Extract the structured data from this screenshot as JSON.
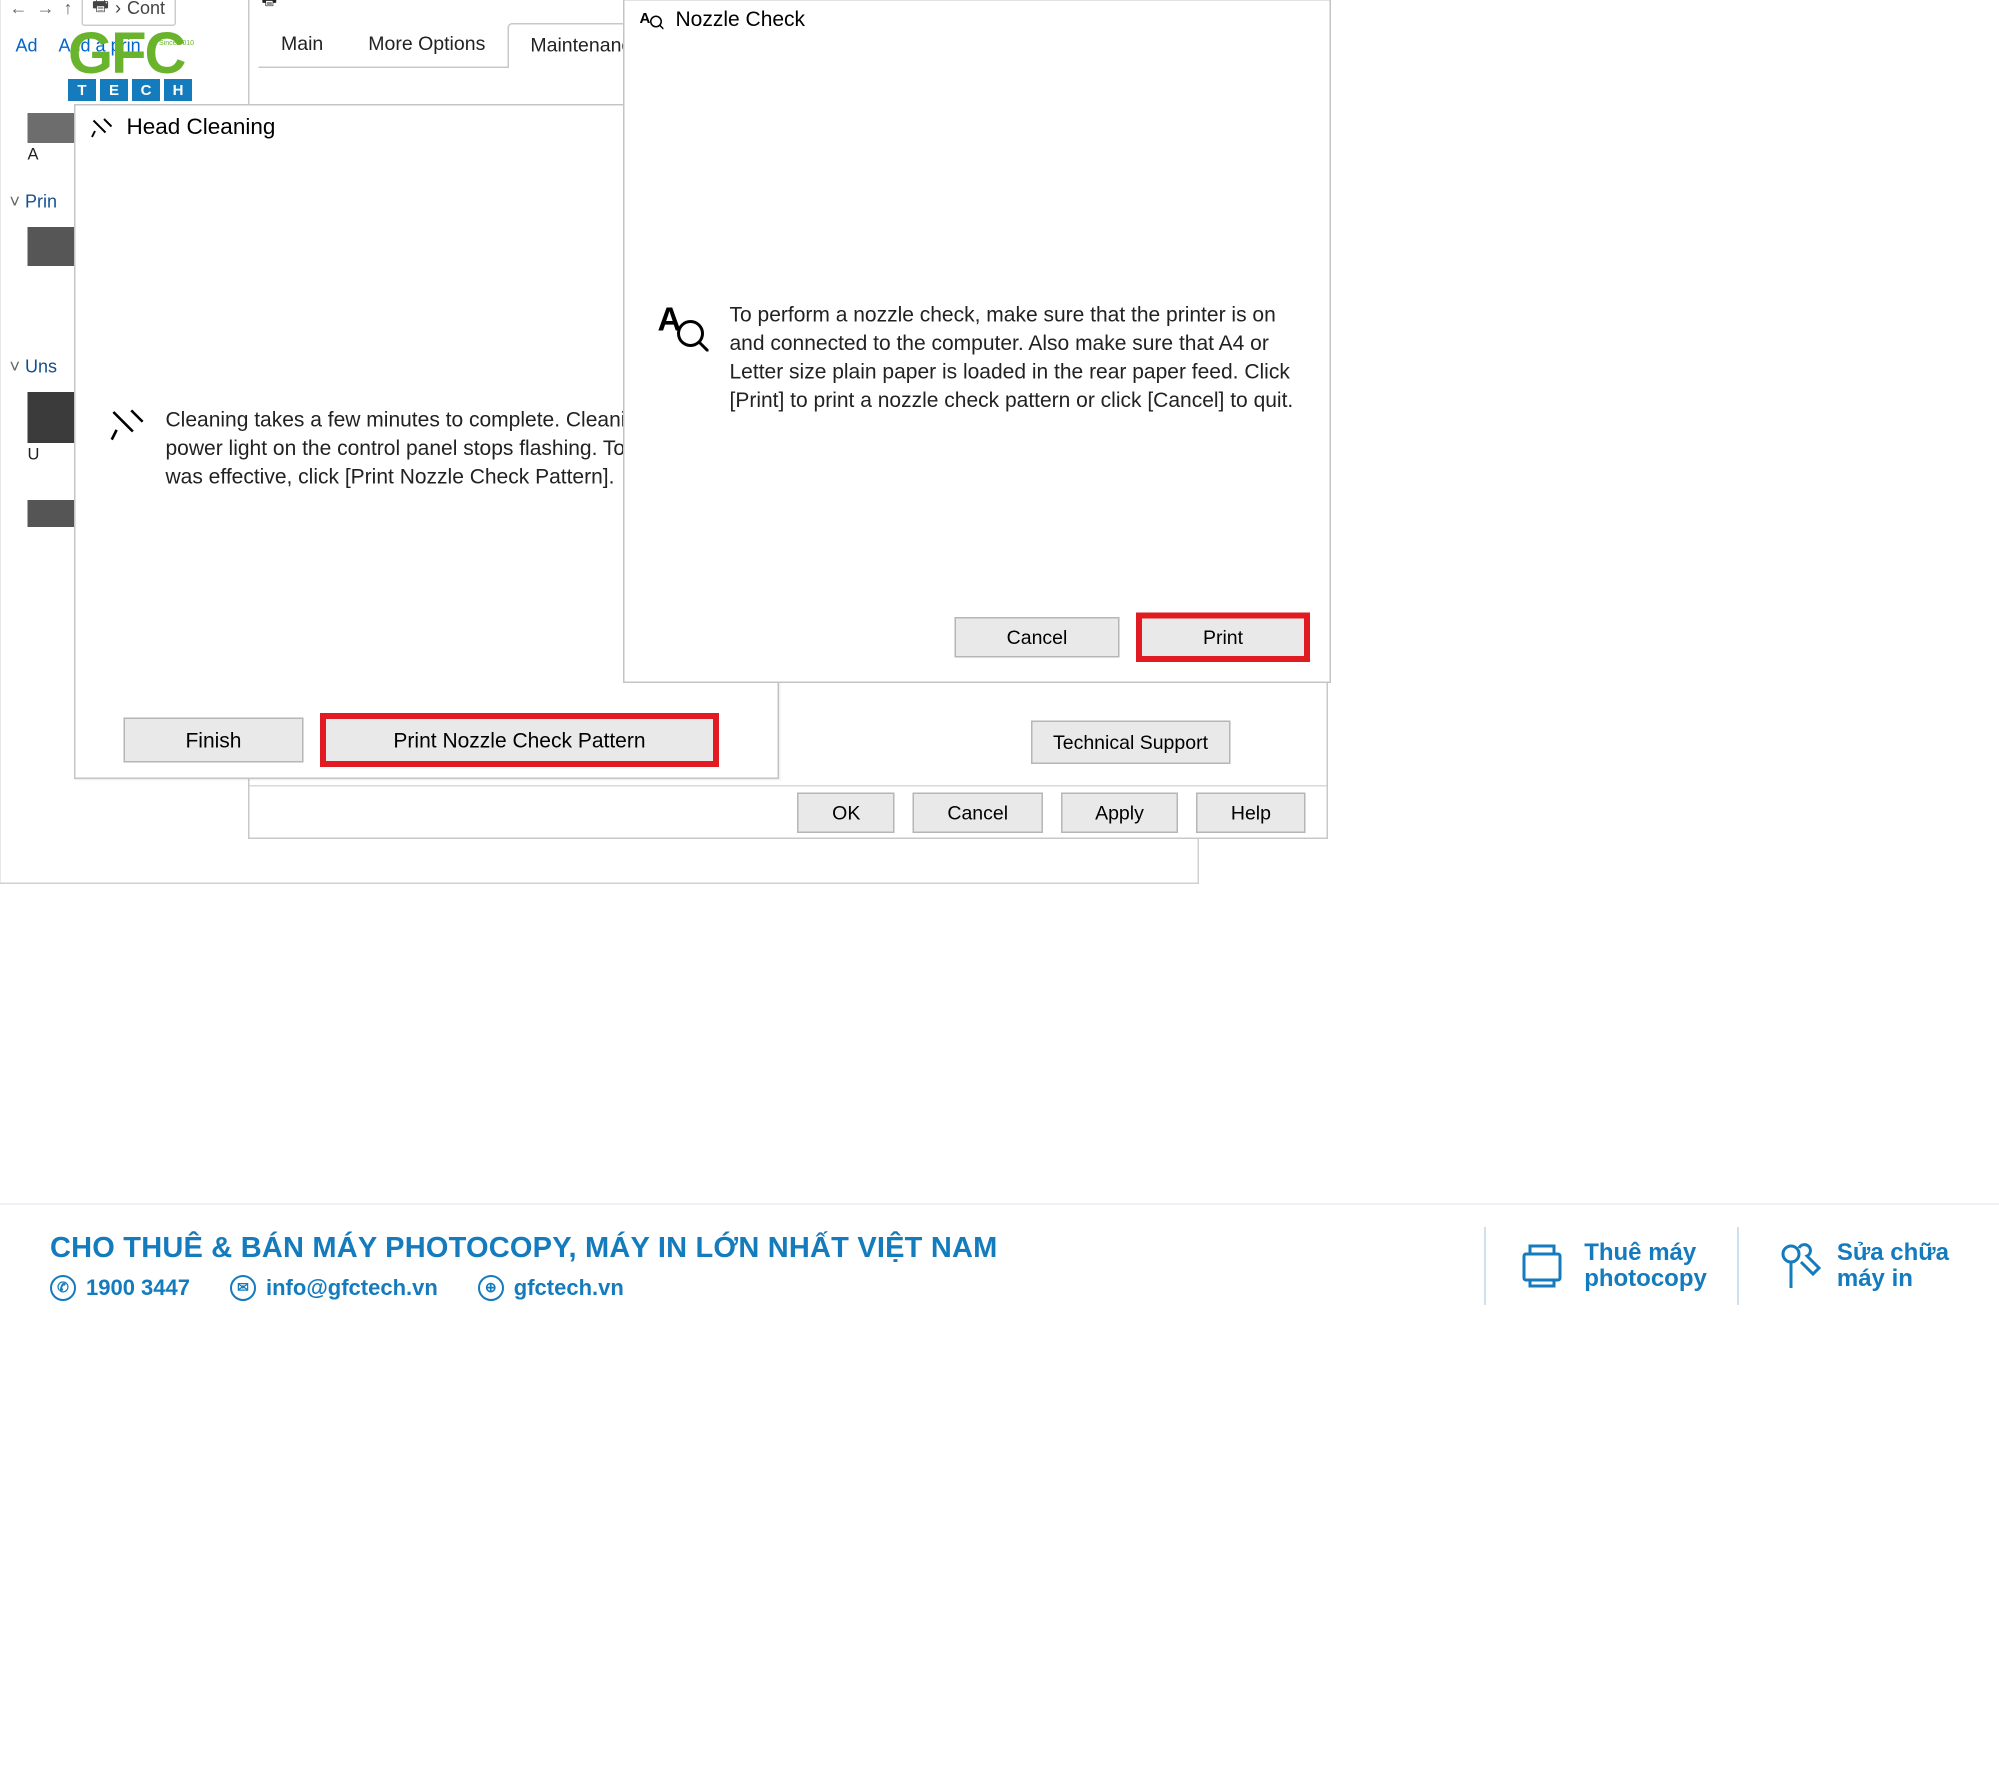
{
  "explorer": {
    "crumb_label": "Cont",
    "cmd_add_device": "Ad",
    "cmd_add_printer": "Add a prin",
    "group_printers": "Prin",
    "dev_label_A": "A",
    "group_unspecified": "Uns",
    "dev_label_U": "U"
  },
  "prefs": {
    "tabs": {
      "main": "Main",
      "more": "More Options",
      "maint": "Maintenance"
    },
    "tech_support": "Technical Support",
    "ok": "OK",
    "cancel": "Cancel",
    "apply": "Apply",
    "help": "Help"
  },
  "headclean": {
    "title": "Head Cleaning",
    "message": "Cleaning takes a few minutes to complete. Cleaning is finished when the power light on the control panel stops flashing. To verify that cleaning was effective, click [Print Nozzle Check Pattern].",
    "message_visible": "Cleaning takes a few minutes to complete. Cleaning is finishe the power light on the control panel stops flashing. To verify cleaning was effective, click [Print Nozzle Check Pattern].",
    "finish": "Finish",
    "print_pattern": "Print Nozzle Check Pattern"
  },
  "nozzle": {
    "title": "Nozzle Check",
    "message": "To perform a nozzle check, make sure that the printer is on and connected to the computer. Also make sure that A4 or Letter size plain paper is loaded in the rear paper feed. Click [Print] to print a nozzle check pattern or click [Cancel] to quit.",
    "cancel": "Cancel",
    "print": "Print"
  },
  "footer": {
    "headline": "CHO THUÊ & BÁN MÁY PHOTOCOPY, MÁY IN LỚN NHẤT VIỆT NAM",
    "phone": "1900 3447",
    "email": "info@gfctech.vn",
    "site": "gfctech.vn",
    "svc1a": "Thuê máy",
    "svc1b": "photocopy",
    "svc2a": "Sửa chữa",
    "svc2b": "máy in"
  },
  "logo": {
    "brand": "GFC",
    "since": "Since 2010",
    "tech": [
      "T",
      "E",
      "C",
      "H"
    ]
  }
}
